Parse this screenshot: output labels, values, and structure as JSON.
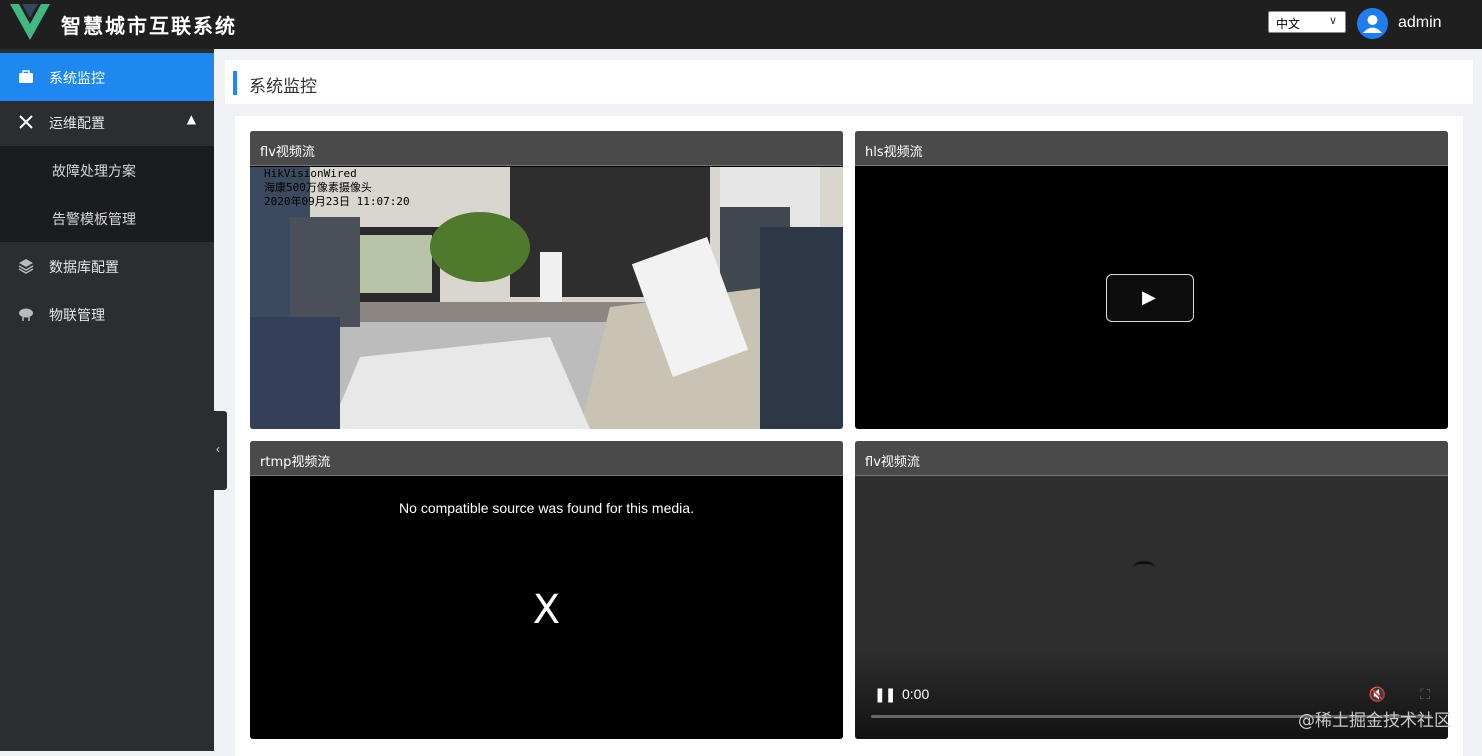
{
  "app": {
    "title": "智慧城市互联系统"
  },
  "header": {
    "language": "中文",
    "username": "admin"
  },
  "sidebar": {
    "items": [
      {
        "label": "系统监控"
      },
      {
        "label": "运维配置"
      },
      {
        "label": "故障处理方案"
      },
      {
        "label": "告警模板管理"
      },
      {
        "label": "数据库配置"
      },
      {
        "label": "物联管理"
      }
    ]
  },
  "page": {
    "title": "系统监控"
  },
  "panels": [
    {
      "title": "flv视频流",
      "overlay": [
        "HikVisionWired",
        "海康500万像素摄像头",
        "2020年09月23日 11:07:20"
      ]
    },
    {
      "title": "hls视频流"
    },
    {
      "title": "rtmp视频流",
      "error": "No compatible source was found for this media.",
      "error_icon": "X"
    },
    {
      "title": "flv视频流",
      "time": "0:00"
    }
  ],
  "watermark": "@稀土掘金技术社区",
  "colors": {
    "accent": "#1e88f0",
    "topbar": "#1f1f1f",
    "sidebar": "#2b2d30"
  }
}
